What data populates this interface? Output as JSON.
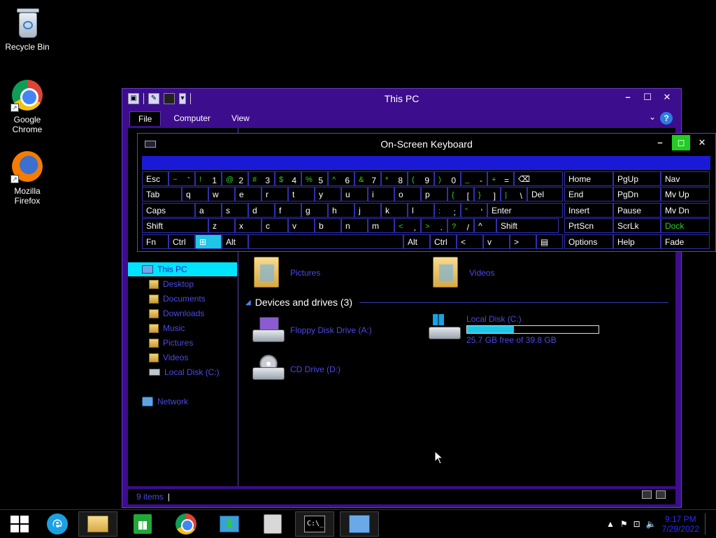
{
  "desktop": {
    "icons": [
      {
        "label": "Recycle Bin"
      },
      {
        "label": "Google Chrome"
      },
      {
        "label": "Mozilla Firefox"
      }
    ]
  },
  "explorer": {
    "title": "This PC",
    "ribbon_tabs": [
      "File",
      "Computer",
      "View"
    ],
    "nav": {
      "this_pc": "This PC",
      "items": [
        "Desktop",
        "Documents",
        "Downloads",
        "Music",
        "Pictures",
        "Videos",
        "Local Disk (C:)"
      ],
      "network": "Network"
    },
    "folders": [
      {
        "label": "Pictures"
      },
      {
        "label": "Videos"
      }
    ],
    "devices_header": "Devices and drives (3)",
    "drives": [
      {
        "label": "Floppy Disk Drive (A:)"
      },
      {
        "label": "Local Disk (C:)",
        "free_text": "25.7 GB free of 39.8 GB",
        "used_fraction": 0.354
      },
      {
        "label": "CD Drive (D:)"
      }
    ],
    "status": "9 items"
  },
  "osk": {
    "title": "On-Screen Keyboard",
    "rows": [
      [
        {
          "main": "Esc"
        },
        {
          "top": "~",
          "bot": "`"
        },
        {
          "top": "!",
          "bot": "1"
        },
        {
          "top": "@",
          "bot": "2"
        },
        {
          "top": "#",
          "bot": "3"
        },
        {
          "top": "$",
          "bot": "4"
        },
        {
          "top": "%",
          "bot": "5"
        },
        {
          "top": "^",
          "bot": "6"
        },
        {
          "top": "&",
          "bot": "7"
        },
        {
          "top": "*",
          "bot": "8"
        },
        {
          "top": "(",
          "bot": "9"
        },
        {
          "top": ")",
          "bot": "0"
        },
        {
          "top": "_",
          "bot": "-"
        },
        {
          "top": "+",
          "bot": "="
        },
        {
          "main": "⌫"
        }
      ],
      [
        {
          "main": "Tab"
        },
        {
          "main": "q"
        },
        {
          "main": "w"
        },
        {
          "main": "e"
        },
        {
          "main": "r"
        },
        {
          "main": "t"
        },
        {
          "main": "y"
        },
        {
          "main": "u"
        },
        {
          "main": "i"
        },
        {
          "main": "o"
        },
        {
          "main": "p"
        },
        {
          "top": "{",
          "bot": "["
        },
        {
          "top": "}",
          "bot": "]"
        },
        {
          "top": "|",
          "bot": "\\"
        },
        {
          "main": "Del"
        }
      ],
      [
        {
          "main": "Caps"
        },
        {
          "main": "a"
        },
        {
          "main": "s"
        },
        {
          "main": "d"
        },
        {
          "main": "f"
        },
        {
          "main": "g"
        },
        {
          "main": "h"
        },
        {
          "main": "j"
        },
        {
          "main": "k"
        },
        {
          "main": "l"
        },
        {
          "top": ":",
          "bot": ";"
        },
        {
          "top": "\"",
          "bot": "'"
        },
        {
          "main": "Enter"
        }
      ],
      [
        {
          "main": "Shift"
        },
        {
          "main": "z"
        },
        {
          "main": "x"
        },
        {
          "main": "c"
        },
        {
          "main": "v"
        },
        {
          "main": "b"
        },
        {
          "main": "n"
        },
        {
          "main": "m"
        },
        {
          "top": "<",
          "bot": ","
        },
        {
          "top": ">",
          "bot": "."
        },
        {
          "top": "?",
          "bot": "/"
        },
        {
          "main": "^"
        },
        {
          "main": "Shift"
        }
      ],
      [
        {
          "main": "Fn"
        },
        {
          "main": "Ctrl"
        },
        {
          "main": "⊞"
        },
        {
          "main": "Alt"
        },
        {
          "main": ""
        },
        {
          "main": "Alt"
        },
        {
          "main": "Ctrl"
        },
        {
          "main": "<"
        },
        {
          "main": "v"
        },
        {
          "main": ">"
        },
        {
          "main": "▤"
        }
      ]
    ],
    "nav_keys": [
      [
        "Home",
        "PgUp",
        "Nav"
      ],
      [
        "End",
        "PgDn",
        "Mv Up"
      ],
      [
        "Insert",
        "Pause",
        "Mv Dn"
      ],
      [
        "PrtScn",
        "ScrLk",
        "Dock"
      ],
      [
        "Options",
        "Help",
        "Fade"
      ]
    ]
  },
  "taskbar": {
    "time": "9:17 PM",
    "date": "7/29/2022"
  },
  "colors": {
    "window_frame": "#3c0d8c",
    "link_blue": "#4a4ae8",
    "accent_cyan": "#1fc7e6",
    "key_green": "#2bd12b"
  }
}
